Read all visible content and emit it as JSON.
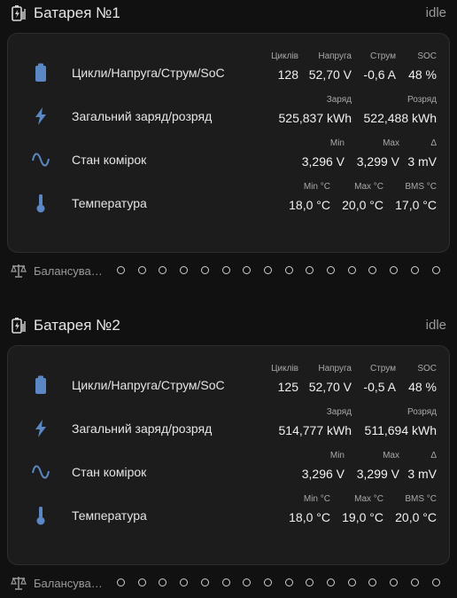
{
  "batteries": [
    {
      "title": "Батарея №1",
      "state": "idle",
      "rows": [
        {
          "icon": "battery-icon",
          "label": "Цикли/Напруга/Струм/SoC",
          "cells": [
            {
              "cap": "Циклів",
              "val": "128"
            },
            {
              "cap": "Напруга",
              "val": "52,70 V"
            },
            {
              "cap": "Струм",
              "val": "-0,6 A"
            },
            {
              "cap": "SOC",
              "val": "48 %"
            }
          ]
        },
        {
          "icon": "lightning-icon",
          "label": "Загальний заряд/розряд",
          "cells": [
            {
              "cap": "Заряд",
              "val": "525,837 kWh"
            },
            {
              "cap": "Розряд",
              "val": "522,488 kWh"
            }
          ]
        },
        {
          "icon": "sine-wave-icon",
          "label": "Стан комірок",
          "cells": [
            {
              "cap": "Min",
              "val": "3,296 V"
            },
            {
              "cap": "Max",
              "val": "3,299 V"
            },
            {
              "cap": "Δ",
              "val": "3 mV"
            }
          ]
        },
        {
          "icon": "thermometer-icon",
          "label": "Температура",
          "cells": [
            {
              "cap": "Min °C",
              "val": "18,0 °C"
            },
            {
              "cap": "Max °C",
              "val": "20,0 °C"
            },
            {
              "cap": "BMS °C",
              "val": "17,0 °C"
            }
          ]
        }
      ],
      "balancing_label": "Балансува…"
    },
    {
      "title": "Батарея №2",
      "state": "idle",
      "rows": [
        {
          "icon": "battery-icon",
          "label": "Цикли/Напруга/Струм/SoC",
          "cells": [
            {
              "cap": "Циклів",
              "val": "125"
            },
            {
              "cap": "Напруга",
              "val": "52,70 V"
            },
            {
              "cap": "Струм",
              "val": "-0,5 A"
            },
            {
              "cap": "SOC",
              "val": "48 %"
            }
          ]
        },
        {
          "icon": "lightning-icon",
          "label": "Загальний заряд/розряд",
          "cells": [
            {
              "cap": "Заряд",
              "val": "514,777 kWh"
            },
            {
              "cap": "Розряд",
              "val": "511,694 kWh"
            }
          ]
        },
        {
          "icon": "sine-wave-icon",
          "label": "Стан комірок",
          "cells": [
            {
              "cap": "Min",
              "val": "3,296 V"
            },
            {
              "cap": "Max",
              "val": "3,299 V"
            },
            {
              "cap": "Δ",
              "val": "3 mV"
            }
          ]
        },
        {
          "icon": "thermometer-icon",
          "label": "Температура",
          "cells": [
            {
              "cap": "Min °C",
              "val": "18,0 °C"
            },
            {
              "cap": "Max °C",
              "val": "19,0 °C"
            },
            {
              "cap": "BMS °C",
              "val": "20,0 °C"
            }
          ]
        }
      ],
      "balancing_label": "Балансува…"
    }
  ],
  "colors": {
    "icon": "#5b88c4",
    "background": "#111111",
    "card": "#1c1c1c"
  }
}
